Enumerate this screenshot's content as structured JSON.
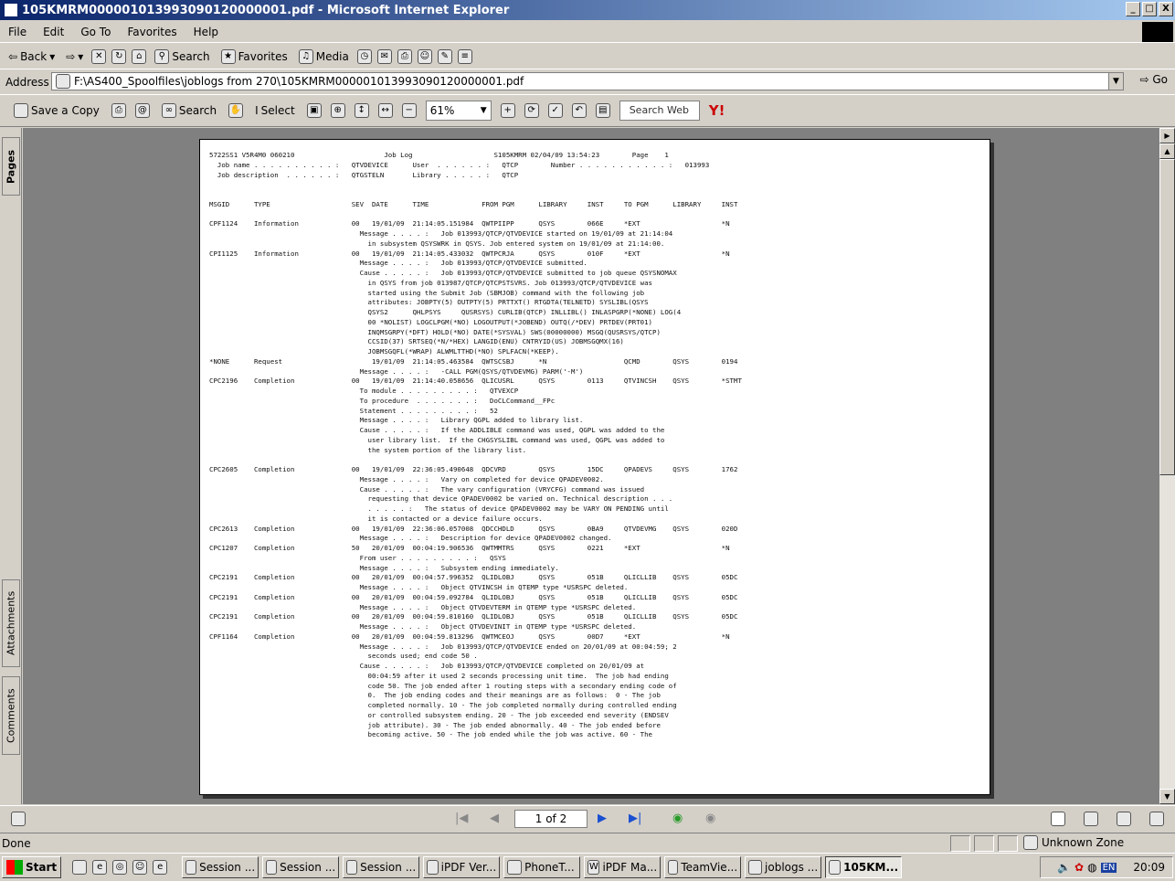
{
  "window": {
    "title": "105KMRM000001013993090120000001.pdf - Microsoft Internet Explorer",
    "controls": [
      "_",
      "□",
      "X"
    ]
  },
  "menu": [
    "File",
    "Edit",
    "Go To",
    "Favorites",
    "Help"
  ],
  "toolbar": {
    "back": "Back",
    "search": "Search",
    "favorites": "Favorites",
    "media": "Media"
  },
  "address": {
    "label": "Address",
    "value": "F:\\AS400_Spoolfiles\\joblogs from 270\\105KMRM000001013993090120000001.pdf",
    "go": "Go"
  },
  "pdf_toolbar": {
    "save": "Save a Copy",
    "search": "Search",
    "select": "Select",
    "zoom": "61%",
    "search_web": "Search Web"
  },
  "side_tabs": [
    "Pages",
    "Attachments",
    "Comments"
  ],
  "document_lines": [
    "5722SS1 V5R4M0 060210                      Job Log                    S105KMRM 02/04/09 13:54:23        Page    1",
    "  Job name . . . . . . . . . . :   QTVDEVICE      User  . . . . . . :   QTCP        Number . . . . . . . . . . . :   013993",
    "  Job description  . . . . . . :   QTGSTELN       Library . . . . . :   QTCP",
    "",
    "",
    "MSGID      TYPE                    SEV  DATE      TIME             FROM PGM      LIBRARY     INST     TO PGM      LIBRARY     INST",
    "",
    "CPF1124    Information             00   19/01/09  21:14:05.151984  QWTPIIPP      QSYS        066E     *EXT                    *N",
    "                                     Message . . . . :   Job 013993/QTCP/QTVDEVICE started on 19/01/09 at 21:14:04",
    "                                       in subsystem QSYSWRK in QSYS. Job entered system on 19/01/09 at 21:14:00.",
    "CPI1125    Information             00   19/01/09  21:14:05.433032  QWTPCRJA      QSYS        010F     *EXT                    *N",
    "                                     Message . . . . :   Job 013993/QTCP/QTVDEVICE submitted.",
    "                                     Cause . . . . . :   Job 013993/QTCP/QTVDEVICE submitted to job queue QSYSNOMAX",
    "                                       in QSYS from job 013987/QTCP/QTCPSTSVRS. Job 013993/QTCP/QTVDEVICE was",
    "                                       started using the Submit Job (SBMJOB) command with the following job",
    "                                       attributes: JOBPTY(5) OUTPTY(5) PRTTXT() RTGDTA(TELNETD) SYSLIBL(QSYS",
    "                                       QSYS2      QHLPSYS     QUSRSYS) CURLIB(QTCP) INLLIBL() INLASPGRP(*NONE) LOG(4",
    "                                       00 *NOLIST) LOGCLPGM(*NO) LOGOUTPUT(*JOBEND) OUTQ(/*DEV) PRTDEV(PRT01)",
    "                                       INQMSGRPY(*DFT) HOLD(*NO) DATE(*SYSVAL) SWS(00000000) MSGQ(QUSRSYS/QTCP)",
    "                                       CCSID(37) SRTSEQ(*N/*HEX) LANGID(ENU) CNTRYID(US) JOBMSGQMX(16)",
    "                                       JOBMSGQFL(*WRAP) ALWMLTTHD(*NO) SPLFACN(*KEEP).",
    "*NONE      Request                      19/01/09  21:14:05.463584  QWTSCSBJ      *N                   QCMD        QSYS        0194",
    "                                     Message . . . . :   -CALL PGM(QSYS/QTVDEVMG) PARM('-M')",
    "CPC2196    Completion              00   19/01/09  21:14:40.058656  QLICUSRL      QSYS        0113     QTVINCSH    QSYS        *STMT",
    "                                     To module . . . . . . . . . :   QTVEXCP",
    "                                     To procedure  . . . . . . . :   DoCLCommand__FPc",
    "                                     Statement . . . . . . . . . :   52",
    "                                     Message . . . . :   Library QGPL added to library list.",
    "                                     Cause . . . . . :   If the ADDLIBLE command was used, QGPL was added to the",
    "                                       user library list.  If the CHGSYSLIBL command was used, QGPL was added to",
    "                                       the system portion of the library list.",
    "",
    "CPC2605    Completion              00   19/01/09  22:36:05.490648  QDCVRD        QSYS        15DC     QPADEVS     QSYS        1762",
    "                                     Message . . . . :   Vary on completed for device QPADEV0002.",
    "                                     Cause . . . . . :   The vary configuration (VRYCFG) command was issued",
    "                                       requesting that device QPADEV0002 be varied on. Technical description . . .",
    "                                       . . . . . :   The status of device QPADEV0002 may be VARY ON PENDING until",
    "                                       it is contacted or a device failure occurs.",
    "CPC2613    Completion              00   19/01/09  22:36:06.057008  QDCCHDLD      QSYS        0BA9     QTVDEVMG    QSYS        020D",
    "                                     Message . . . . :   Description for device QPADEV0002 changed.",
    "CPC1207    Completion              50   20/01/09  00:04:19.906536  QWTMMTRS      QSYS        0221     *EXT                    *N",
    "                                     From user . . . . . . . . . :   QSYS",
    "                                     Message . . . . :   Subsystem ending immediately.",
    "CPC2191    Completion              00   20/01/09  00:04:57.996352  QLIDLOBJ      QSYS        051B     QLICLLIB    QSYS        05DC",
    "                                     Message . . . . :   Object QTVINCSH in QTEMP type *USRSPC deleted.",
    "CPC2191    Completion              00   20/01/09  00:04:59.092784  QLIDLOBJ      QSYS        051B     QLICLLIB    QSYS        05DC",
    "                                     Message . . . . :   Object QTVDEVTERM in QTEMP type *USRSPC deleted.",
    "CPC2191    Completion              00   20/01/09  00:04:59.810160  QLIDLOBJ      QSYS        051B     QLICLLIB    QSYS        05DC",
    "                                     Message . . . . :   Object QTVDEVINIT in QTEMP type *USRSPC deleted.",
    "CPF1164    Completion              00   20/01/09  00:04:59.813296  QWTMCEOJ      QSYS        00D7     *EXT                    *N",
    "                                     Message . . . . :   Job 013993/QTCP/QTVDEVICE ended on 20/01/09 at 00:04:59; 2",
    "                                       seconds used; end code 50 .",
    "                                     Cause . . . . . :   Job 013993/QTCP/QTVDEVICE completed on 20/01/09 at",
    "                                       00:04:59 after it used 2 seconds processing unit time.  The job had ending",
    "                                       code 50. The job ended after 1 routing steps with a secondary ending code of",
    "                                       0.  The job ending codes and their meanings are as follows:  0 - The job",
    "                                       completed normally. 10 - The job completed normally during controlled ending",
    "                                       or controlled subsystem ending. 20 - The job exceeded end severity (ENDSEV",
    "                                       job attribute). 30 - The job ended abnormally. 40 - The job ended before",
    "                                       becoming active. 50 - The job ended while the job was active. 60 - The"
  ],
  "nav": {
    "page_indicator": "1 of 2"
  },
  "status": {
    "left": "Done",
    "zone": "Unknown Zone"
  },
  "taskbar": {
    "start": "Start",
    "tasks": [
      "Session ...",
      "Session ...",
      "Session ...",
      "iPDF Ver...",
      "PhoneT...",
      "iPDF Ma...",
      "TeamVie...",
      "joblogs ...",
      "105KM..."
    ],
    "lang": "EN",
    "clock": "20:09"
  }
}
